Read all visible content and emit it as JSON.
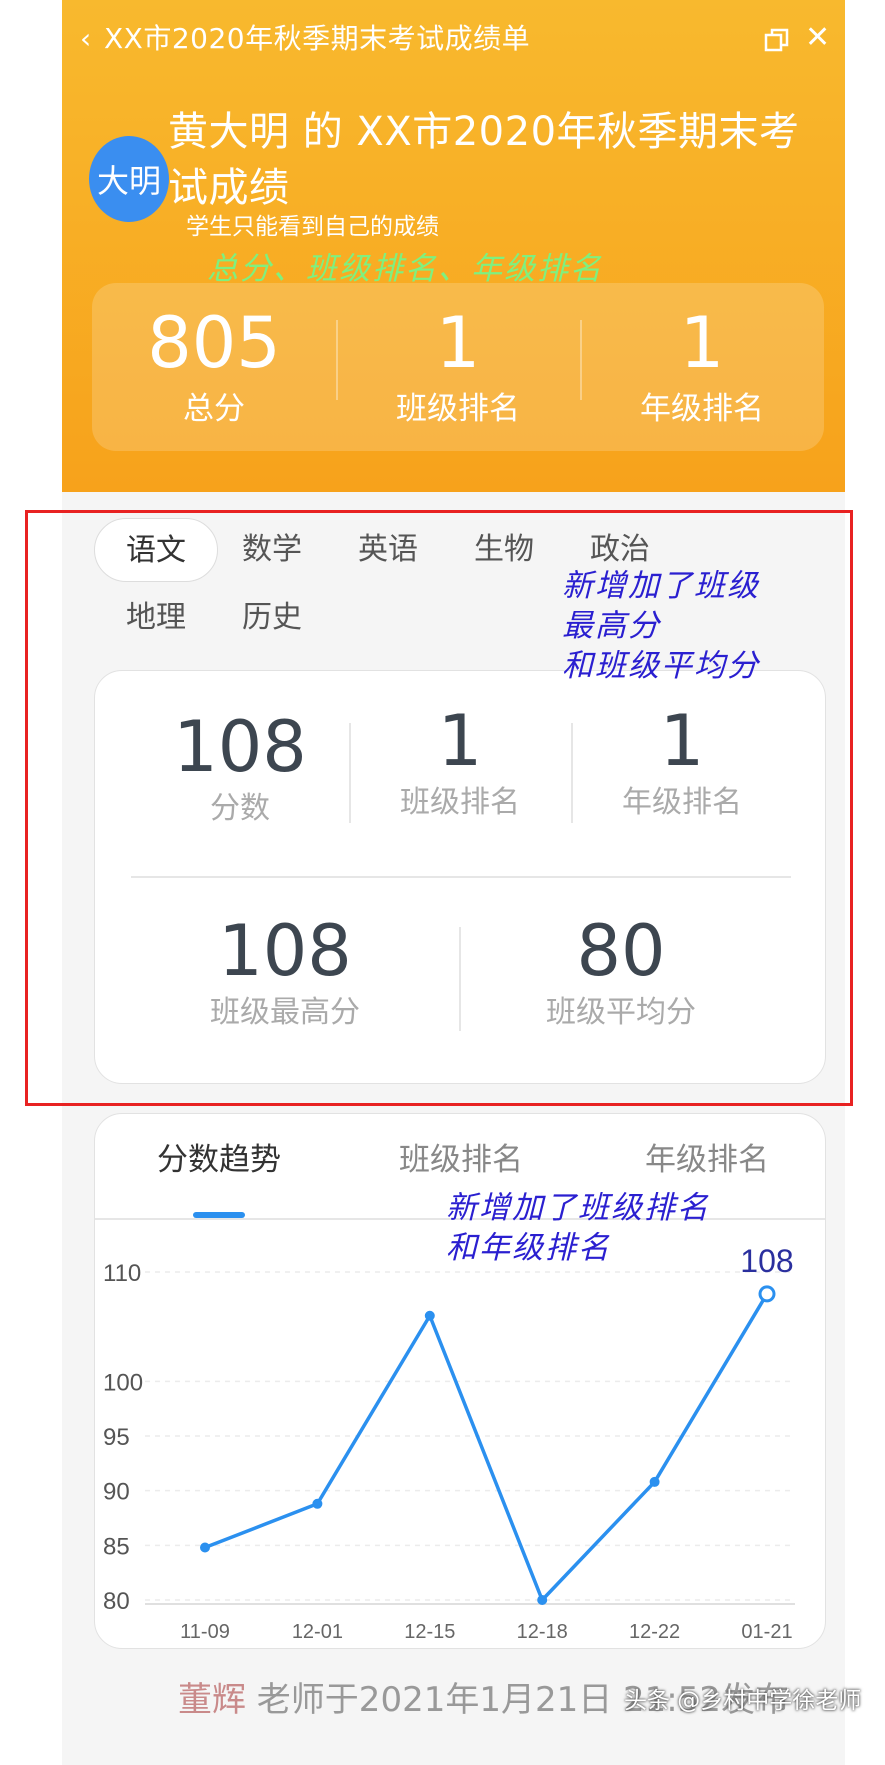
{
  "window": {
    "title": "XX市2020年秋季期末考试成绩单",
    "back_icon": "chevron-left-icon",
    "restore_icon": "restore-window-icon",
    "close_icon": "close-icon"
  },
  "student": {
    "avatar_text": "大明",
    "title": "黄大明 的 XX市2020年秋季期末考试成绩",
    "hint": "学生只能看到自己的成绩"
  },
  "annotations": {
    "summary": "总分、班级排名、年级排名",
    "subject": "新增加了班级\n最高分\n和班级平均分",
    "trend": "新增加了班级排名\n和年级排名"
  },
  "summary": [
    {
      "value": "805",
      "label": "总分"
    },
    {
      "value": "1",
      "label": "班级排名"
    },
    {
      "value": "1",
      "label": "年级排名"
    }
  ],
  "subjects": [
    "语文",
    "数学",
    "英语",
    "生物",
    "政治",
    "地理",
    "历史"
  ],
  "active_subject": "语文",
  "subject_stats": {
    "score": {
      "value": "108",
      "label": "分数"
    },
    "class_rank": {
      "value": "1",
      "label": "班级排名"
    },
    "grade_rank": {
      "value": "1",
      "label": "年级排名"
    },
    "class_max": {
      "value": "108",
      "label": "班级最高分"
    },
    "class_avg": {
      "value": "80",
      "label": "班级平均分"
    }
  },
  "trend_tabs": [
    "分数趋势",
    "班级排名",
    "年级排名"
  ],
  "colors": {
    "accent": "#2b90ef",
    "header": "#f7a21b",
    "annotation_border": "#e82222"
  },
  "chart_data": {
    "type": "line",
    "x": [
      "11-09",
      "12-01",
      "12-15",
      "12-18",
      "12-22",
      "01-21"
    ],
    "values": [
      84.8,
      88.8,
      106,
      80,
      90.8,
      108
    ],
    "yticks": [
      80,
      85,
      90,
      95,
      100,
      110
    ],
    "ylim": [
      80,
      110
    ],
    "last_label": "108",
    "grid": true
  },
  "footer": {
    "teacher": "董辉",
    "text": " 老师于2021年1月21日 21:52发布"
  },
  "watermark": "头条 @乡村中学徐老师"
}
